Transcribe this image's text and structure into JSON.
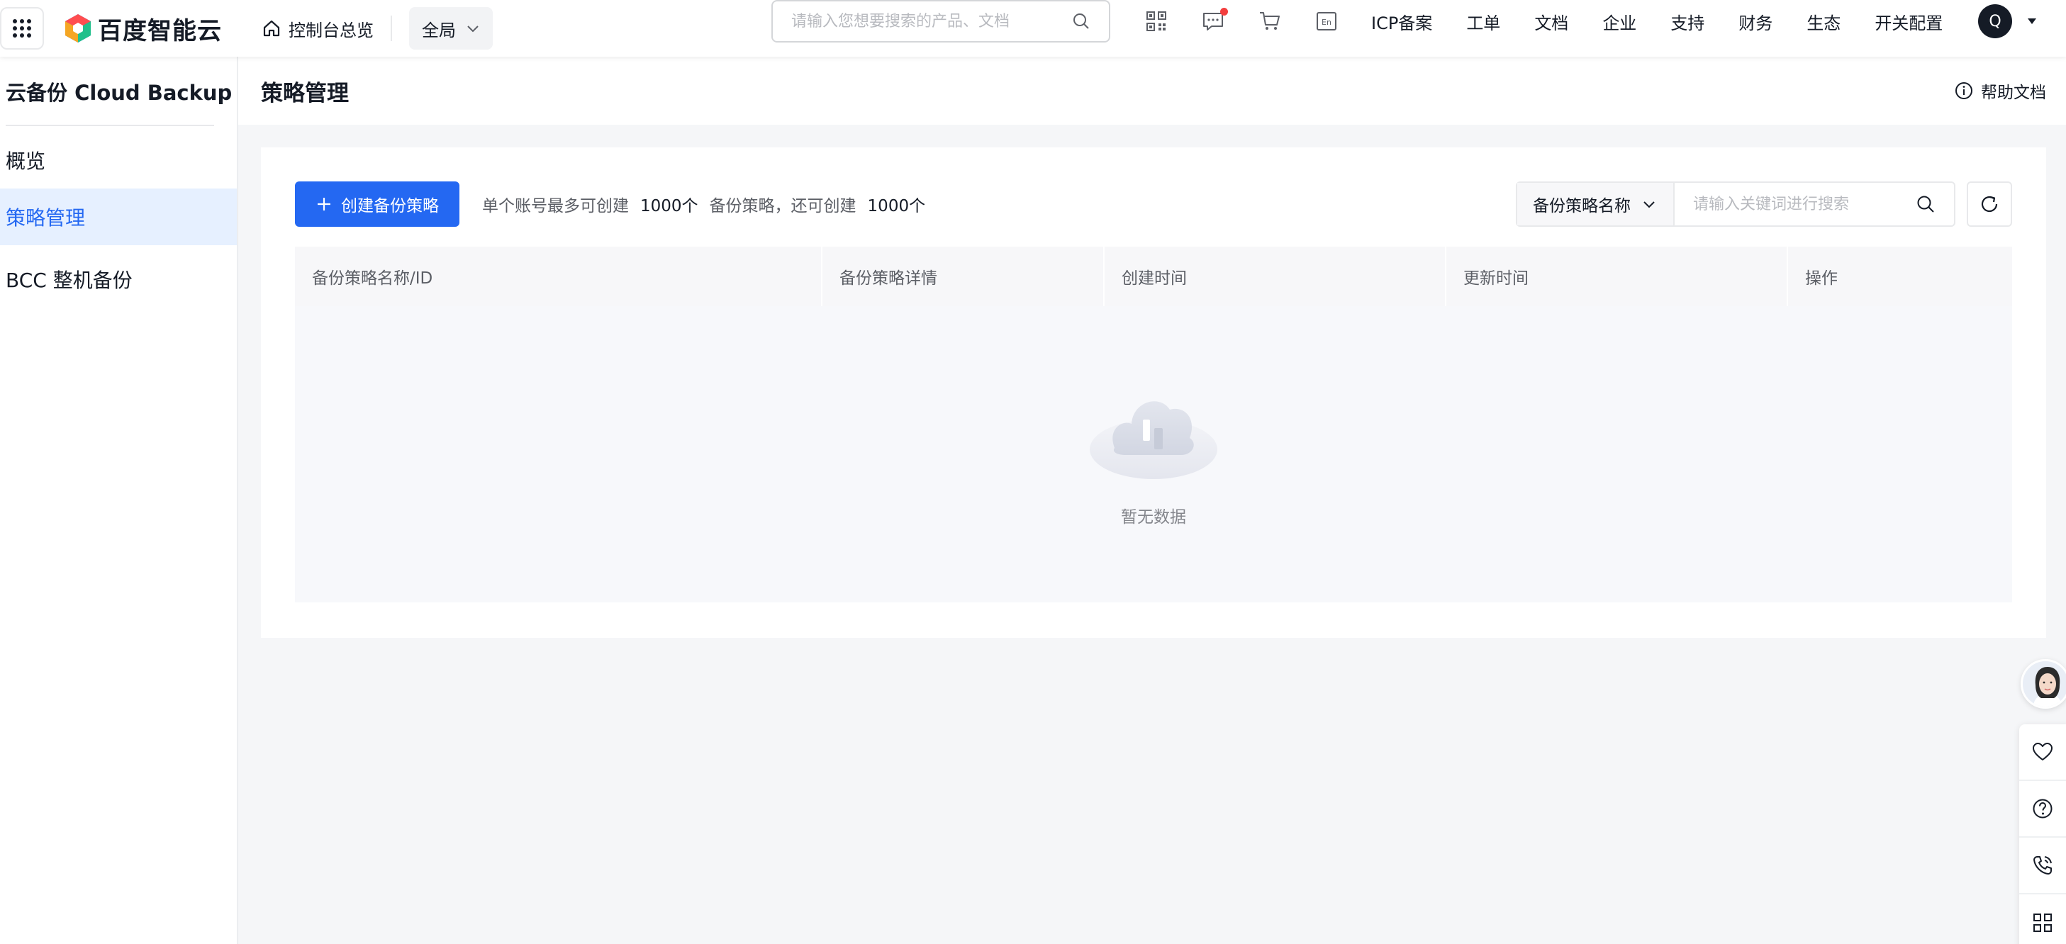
{
  "topbar": {
    "logo_text": "百度智能云",
    "console_home": "控制台总览",
    "region": "全局",
    "search_placeholder": "请输入您想要搜索的产品、文档",
    "nav": [
      "ICP备案",
      "工单",
      "文档",
      "企业",
      "支持",
      "财务",
      "生态",
      "开关配置"
    ],
    "avatar_initial": "Q",
    "icons": [
      "qrcode-icon",
      "message-icon",
      "cart-icon",
      "language-en-icon"
    ]
  },
  "sidebar": {
    "title": "云备份 Cloud Backup",
    "items": [
      {
        "label": "概览",
        "active": false
      },
      {
        "label": "策略管理",
        "active": true
      },
      {
        "label": "BCC 整机备份",
        "active": false
      }
    ]
  },
  "header": {
    "title": "策略管理",
    "help_link": "帮助文档"
  },
  "toolbar": {
    "create_button": "创建备份策略",
    "quota_prefix": "单个账号最多可创建",
    "quota_max": "1000个",
    "quota_middle": "备份策略，还可创建",
    "quota_remaining": "1000个",
    "search_field": "备份策略名称",
    "search_placeholder": "请输入关键词进行搜索"
  },
  "table": {
    "columns": [
      "备份策略名称/ID",
      "备份策略详情",
      "创建时间",
      "更新时间",
      "操作"
    ],
    "rows": [],
    "empty_text": "暂无数据"
  },
  "colors": {
    "primary": "#2468f2",
    "active_bg": "#e6f0ff",
    "notice_dot": "#f33e3e"
  }
}
